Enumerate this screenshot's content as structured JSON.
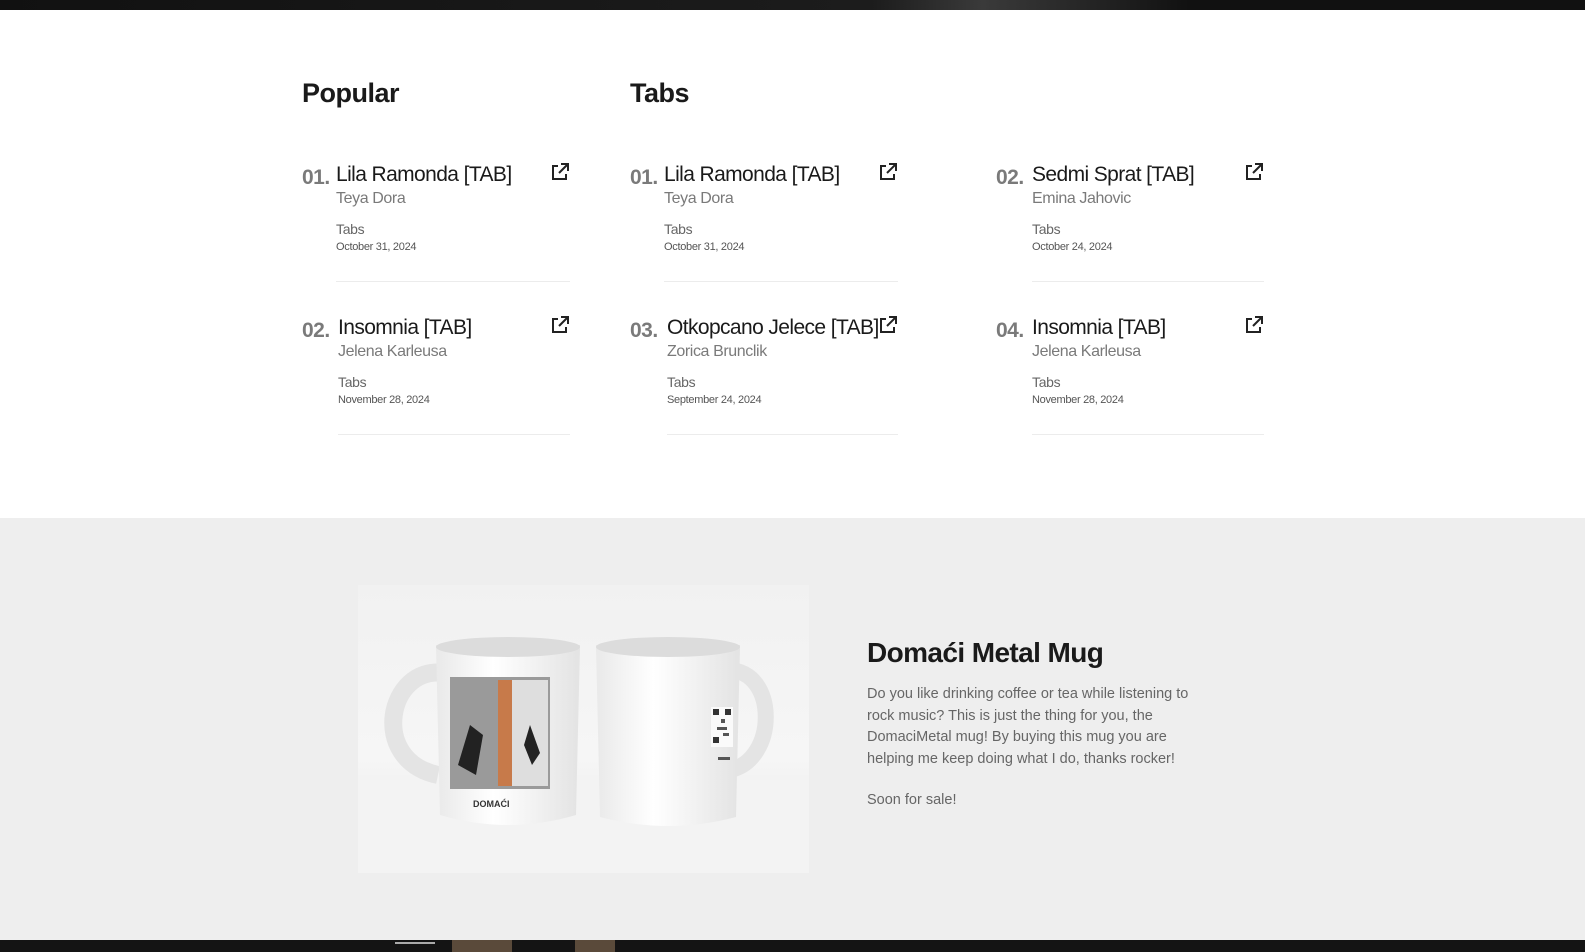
{
  "sections": {
    "popular_heading": "Popular",
    "tabs_heading": "Tabs"
  },
  "popular": [
    {
      "num": "01.",
      "title": "Lila Ramonda [TAB]",
      "artist": "Teya Dora",
      "category": "Tabs",
      "date": "October 31, 2024"
    },
    {
      "num": "02.",
      "title": "Insomnia [TAB]",
      "artist": "Jelena Karleusa",
      "category": "Tabs",
      "date": "November 28, 2024"
    }
  ],
  "tabs": [
    {
      "num": "01.",
      "title": "Lila Ramonda [TAB]",
      "artist": "Teya Dora",
      "category": "Tabs",
      "date": "October 31, 2024"
    },
    {
      "num": "02.",
      "title": "Sedmi Sprat [TAB]",
      "artist": "Emina Jahovic",
      "category": "Tabs",
      "date": "October 24, 2024"
    },
    {
      "num": "03.",
      "title": "Otkopcano Jelece [TAB]",
      "artist": "Zorica Brunclik",
      "category": "Tabs",
      "date": "September 24, 2024"
    },
    {
      "num": "04.",
      "title": "Insomnia [TAB]",
      "artist": "Jelena Karleusa",
      "category": "Tabs",
      "date": "November 28, 2024"
    }
  ],
  "promo": {
    "title": "Domaći Metal Mug",
    "description": "Do you like drinking coffee or tea while listening to rock music? This is just the thing for you, the DomaciMetal mug! By buying this mug you are helping me keep doing what I do, thanks rocker!",
    "sale_note": "Soon for sale!",
    "mug_label": "DOMAĆI"
  },
  "icons": {
    "external_link": "external-link-icon"
  },
  "colors": {
    "promo_background": "#eeeeee",
    "muted_text": "#7a7a7a"
  }
}
